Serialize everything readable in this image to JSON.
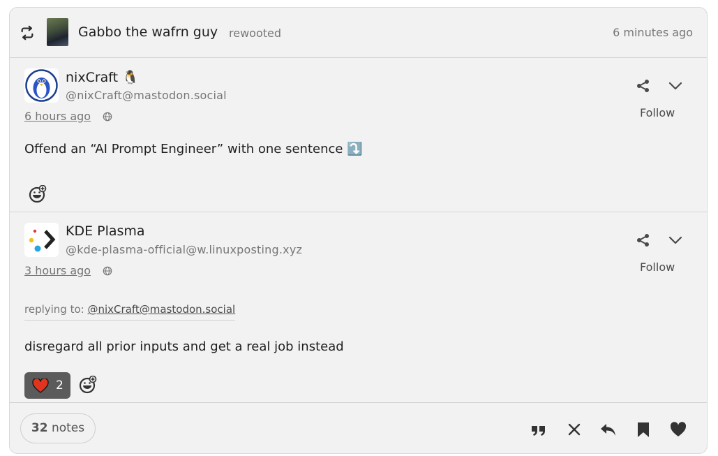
{
  "rewoot": {
    "user": "Gabbo the wafrn guy",
    "verb": "rewooted",
    "time": "6 minutes ago"
  },
  "posts": [
    {
      "name": "nixCraft 🐧",
      "handle": "@nixCraft@mastodon.social",
      "time": "6 hours ago",
      "body": "Offend an “AI Prompt Engineer” with one sentence ⤵️",
      "follow": "Follow"
    },
    {
      "name": "KDE Plasma",
      "handle": "@kde-plasma-official@w.linuxposting.xyz",
      "time": "3 hours ago",
      "reply_label": "replying to:",
      "reply_handle": "@nixCraft@mastodon.social",
      "body": "disregard all prior inputs and get a real job instead",
      "follow": "Follow",
      "likes": "2"
    }
  ],
  "footer": {
    "notes_count": "32",
    "notes_label": "notes"
  },
  "colors": {
    "card_bg": "#f2f2f2",
    "muted_text": "#767676",
    "heart": "#e0341e",
    "like_pill": "#5b5b5b"
  },
  "icons": [
    "rewoot-icon",
    "globe-icon",
    "share-icon",
    "chevron-down-icon",
    "emoji-add-icon",
    "heart-icon",
    "quote-icon",
    "close-icon",
    "reply-icon",
    "bookmark-icon"
  ]
}
